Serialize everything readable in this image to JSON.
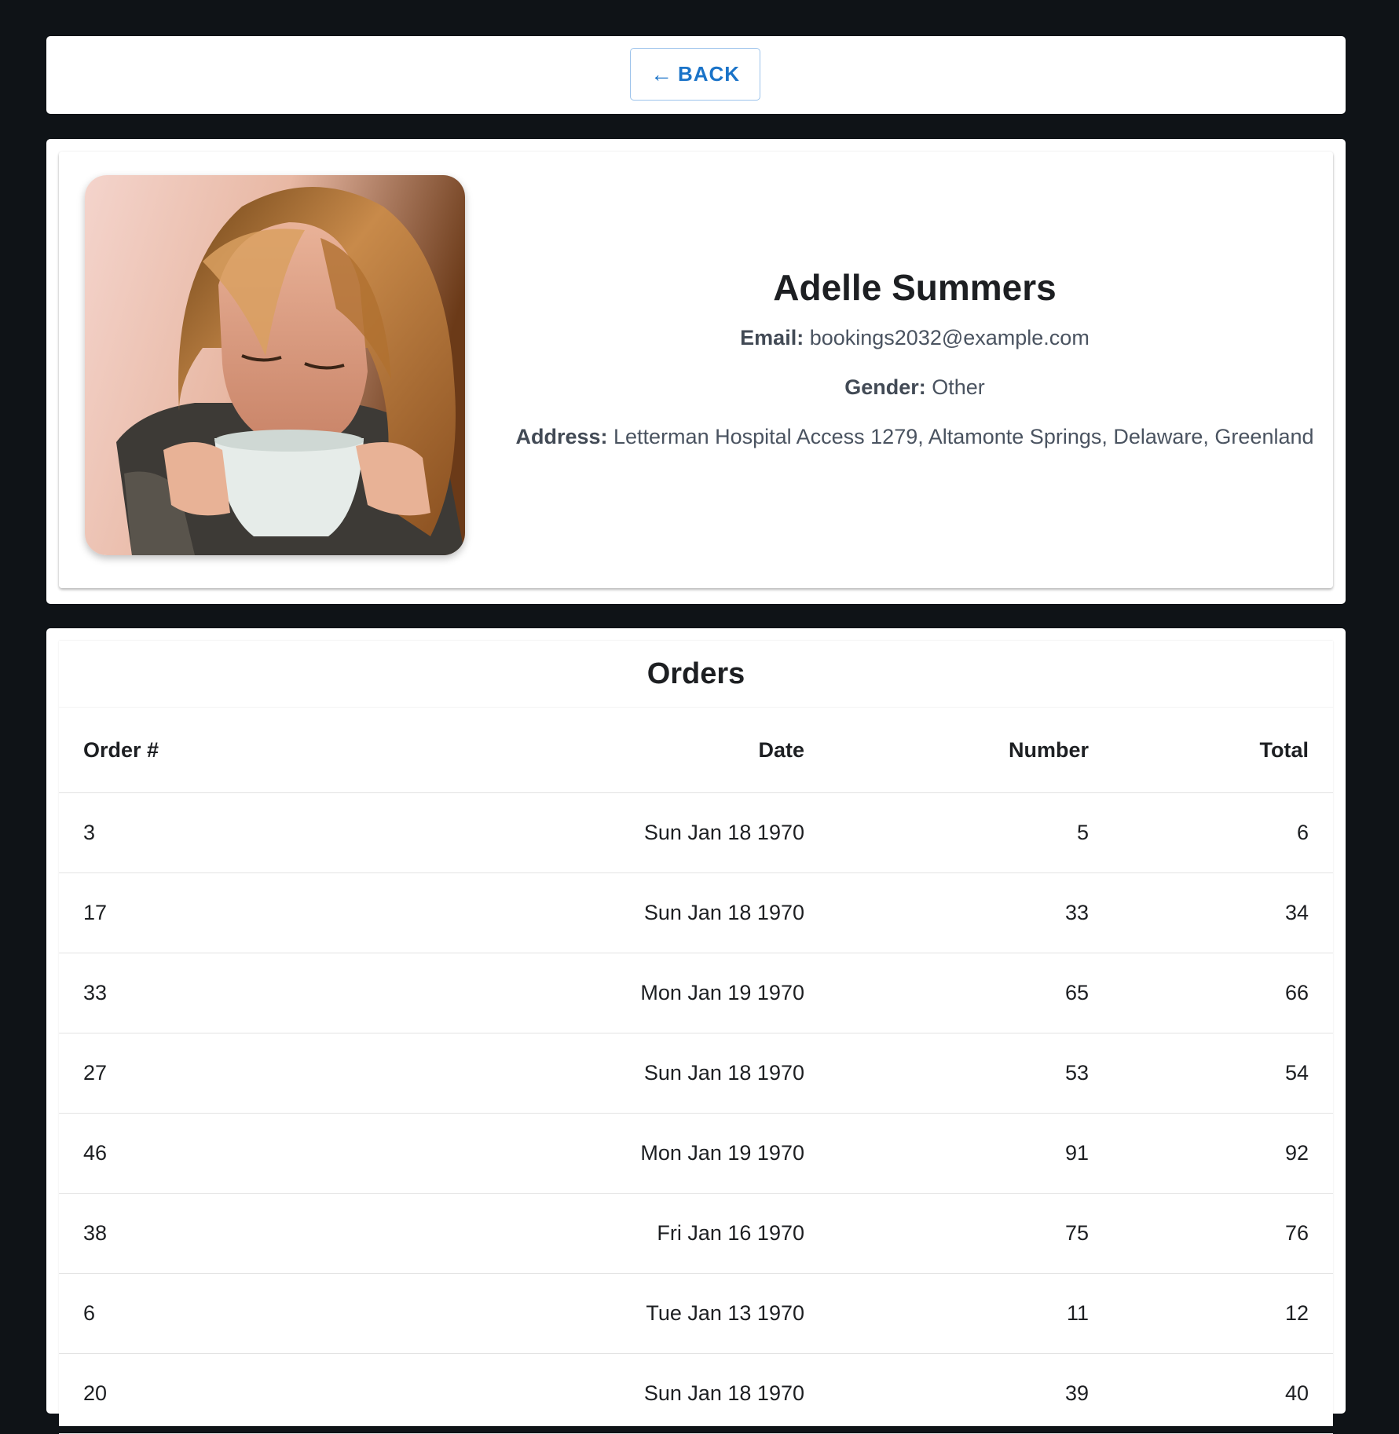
{
  "header": {
    "back_arrow": "←",
    "back_label": "BACK"
  },
  "profile": {
    "name": "Adelle Summers",
    "email_label": "Email:",
    "email": "bookings2032@example.com",
    "gender_label": "Gender:",
    "gender": "Other",
    "address_label": "Address:",
    "address": "Letterman Hospital Access 1279, Altamonte Springs, Delaware, Greenland"
  },
  "orders": {
    "title": "Orders",
    "columns": [
      "Order #",
      "Date",
      "Number",
      "Total"
    ],
    "rows": [
      {
        "order": "3",
        "date": "Sun Jan 18 1970",
        "number": "5",
        "total": "6"
      },
      {
        "order": "17",
        "date": "Sun Jan 18 1970",
        "number": "33",
        "total": "34"
      },
      {
        "order": "33",
        "date": "Mon Jan 19 1970",
        "number": "65",
        "total": "66"
      },
      {
        "order": "27",
        "date": "Sun Jan 18 1970",
        "number": "53",
        "total": "54"
      },
      {
        "order": "46",
        "date": "Mon Jan 19 1970",
        "number": "91",
        "total": "92"
      },
      {
        "order": "38",
        "date": "Fri Jan 16 1970",
        "number": "75",
        "total": "76"
      },
      {
        "order": "6",
        "date": "Tue Jan 13 1970",
        "number": "11",
        "total": "12"
      },
      {
        "order": "20",
        "date": "Sun Jan 18 1970",
        "number": "39",
        "total": "40"
      }
    ]
  },
  "colors": {
    "page_background": "#0f1317",
    "accent": "#1a73c8"
  }
}
